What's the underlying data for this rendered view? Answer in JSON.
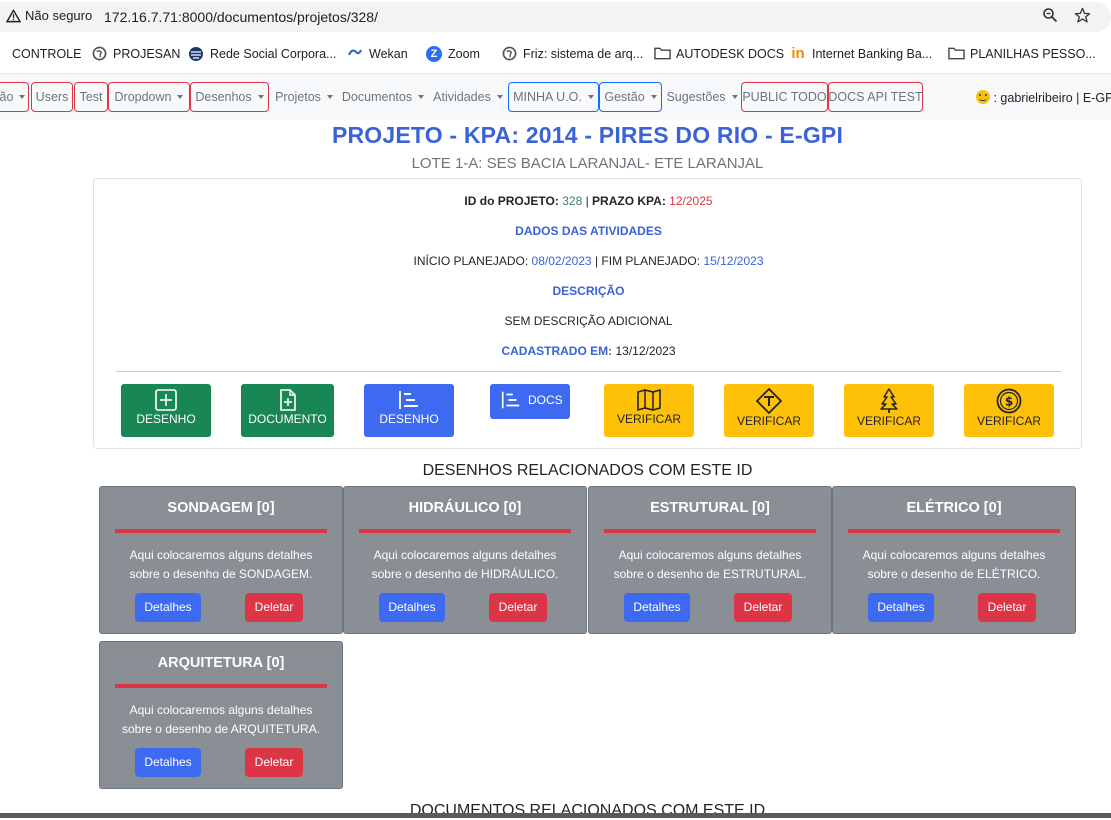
{
  "browser": {
    "security_label": "Não seguro",
    "url": "172.16.7.71:8000/documentos/projetos/328/"
  },
  "bookmarks": [
    {
      "label": "CONTROLE",
      "icon": "bookmark-icon"
    },
    {
      "label": "PROJESAN",
      "icon": "globe-icon"
    },
    {
      "label": "Rede Social Corpora...",
      "icon": "network-icon"
    },
    {
      "label": "Wekan",
      "icon": "wekan-icon"
    },
    {
      "label": "Zoom",
      "icon": "zoom-icon"
    },
    {
      "label": "Friz: sistema de arq...",
      "icon": "globe-icon"
    },
    {
      "label": "AUTODESK DOCS",
      "icon": "folder-icon"
    },
    {
      "label": "Internet Banking Ba...",
      "icon": "bank-icon"
    },
    {
      "label": "PLANILHAS PESSO...",
      "icon": "folder-icon"
    }
  ],
  "nav": {
    "items": [
      {
        "label": "ão",
        "dropdown": true
      },
      {
        "label": "Users",
        "dropdown": false
      },
      {
        "label": "Test",
        "dropdown": false
      },
      {
        "label": "Dropdown",
        "dropdown": true
      },
      {
        "label": "Desenhos",
        "dropdown": true
      },
      {
        "label": "Projetos",
        "dropdown": true
      },
      {
        "label": "Documentos",
        "dropdown": true
      },
      {
        "label": "Atividades",
        "dropdown": true
      },
      {
        "label": "MINHA U.O.",
        "dropdown": true
      },
      {
        "label": "Gestão",
        "dropdown": true
      },
      {
        "label": "Sugestões",
        "dropdown": true
      },
      {
        "label": "PUBLIC TODO",
        "dropdown": false
      },
      {
        "label": "DOCS API TEST",
        "dropdown": false
      }
    ],
    "user": ": gabrielribeiro | E-GPI"
  },
  "header": {
    "title": "PROJETO - KPA: 2014 - PIRES DO RIO - E-GPI",
    "subtitle": "LOTE 1-A: SES BACIA LARANJAL- ETE LARANJAL"
  },
  "info": {
    "id_label": "ID do PROJETO:",
    "id_value": "328",
    "prazo_label": "PRAZO KPA:",
    "prazo_value": "12/2025",
    "dados_heading": "DADOS DAS ATIVIDADES",
    "inicio_label": "INÍCIO PLANEJADO:",
    "inicio_value": "08/02/2023",
    "fim_label": "FIM PLANEJADO:",
    "fim_value": "15/12/2023",
    "descricao_heading": "DESCRIÇÃO",
    "descricao_value": "SEM DESCRIÇÃO ADICIONAL",
    "cadastrado_label": "CADASTRADO EM:",
    "cadastrado_value": "13/12/2023"
  },
  "actions": [
    {
      "label": "DESENHO",
      "icon": "plus-square-icon",
      "color": "#198754"
    },
    {
      "label": "DOCUMENTO",
      "icon": "file-plus-icon",
      "color": "#198754"
    },
    {
      "label": "DESENHO",
      "icon": "list-nested-icon",
      "color": "#3d6af0"
    },
    {
      "label": "DOCS",
      "icon": "list-nested-icon",
      "color": "#3d6af0"
    },
    {
      "label": "VERIFICAR",
      "icon": "map-icon",
      "color": "#ffc107"
    },
    {
      "label": "VERIFICAR",
      "icon": "sign-icon",
      "color": "#ffc107"
    },
    {
      "label": "VERIFICAR",
      "icon": "tree-icon",
      "color": "#ffc107"
    },
    {
      "label": "VERIFICAR",
      "icon": "coin-icon",
      "color": "#ffc107"
    }
  ],
  "drawings_section": {
    "heading": "DESENHOS RELACIONADOS COM ESTE ID",
    "cards": [
      {
        "title": "SONDAGEM [0]",
        "text1": "Aqui colocaremos alguns detalhes",
        "text2": "sobre o desenho de SONDAGEM.",
        "details": "Detalhes",
        "delete": "Deletar"
      },
      {
        "title": "HIDRÁULICO [0]",
        "text1": "Aqui colocaremos alguns detalhes",
        "text2": "sobre o desenho de HIDRÁULICO.",
        "details": "Detalhes",
        "delete": "Deletar"
      },
      {
        "title": "ESTRUTURAL [0]",
        "text1": "Aqui colocaremos alguns detalhes",
        "text2": "sobre o desenho de ESTRUTURAL.",
        "details": "Detalhes",
        "delete": "Deletar"
      },
      {
        "title": "ELÉTRICO [0]",
        "text1": "Aqui colocaremos alguns detalhes",
        "text2": "sobre o desenho de ELÉTRICO.",
        "details": "Detalhes",
        "delete": "Deletar"
      },
      {
        "title": "ARQUITETURA [0]",
        "text1": "Aqui colocaremos alguns detalhes",
        "text2": "sobre o desenho de ARQUITETURA.",
        "details": "Detalhes",
        "delete": "Deletar"
      }
    ]
  },
  "documents_section": {
    "heading": "DOCUMENTOS RELACIONADOS COM ESTE ID"
  }
}
